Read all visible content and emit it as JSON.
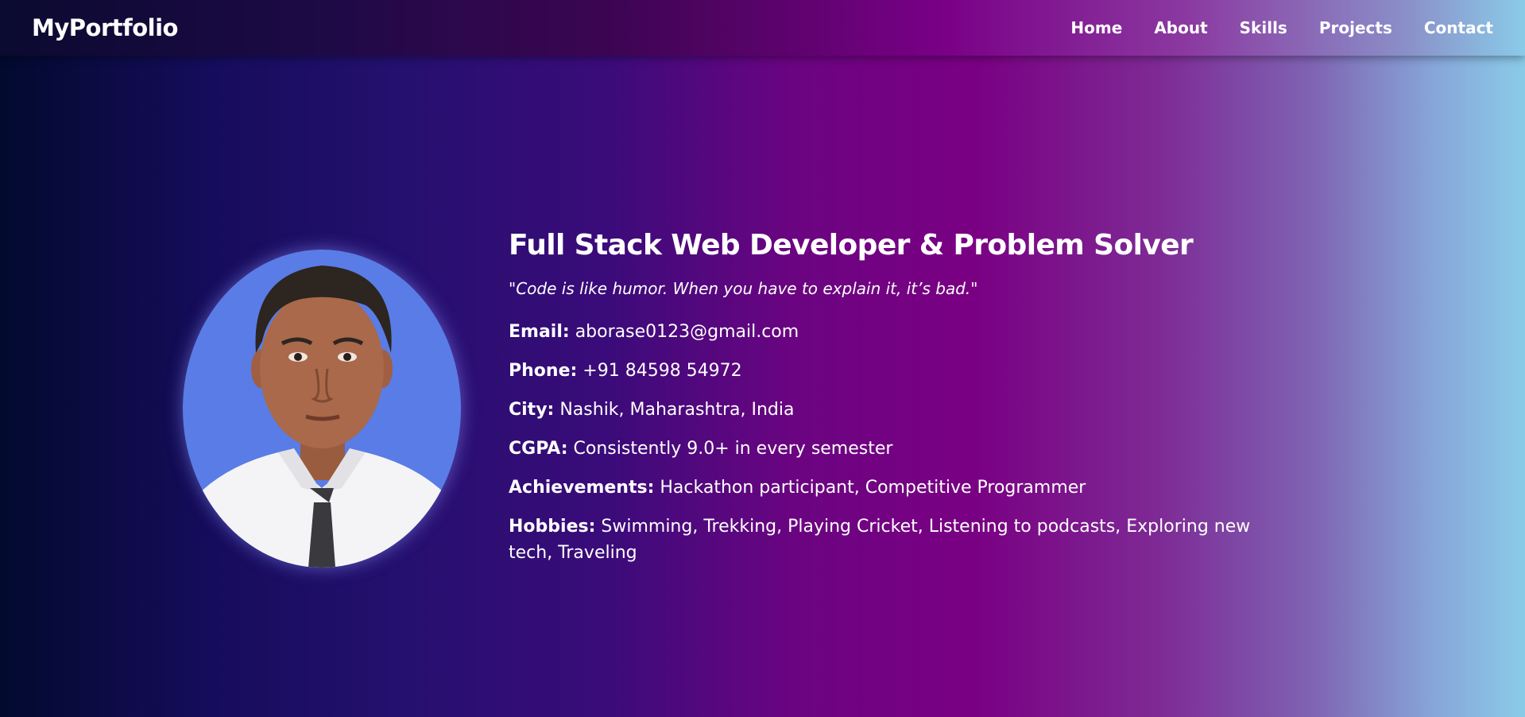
{
  "nav": {
    "logo": "MyPortfolio",
    "links": [
      {
        "label": "Home"
      },
      {
        "label": "About"
      },
      {
        "label": "Skills"
      },
      {
        "label": "Projects"
      },
      {
        "label": "Contact"
      }
    ]
  },
  "profile": {
    "photo_icon": "profile-photo",
    "headline": "Full Stack Web Developer & Problem Solver",
    "quote": "\"Code is like humor. When you have to explain it, it’s bad.\"",
    "details": [
      {
        "key": "Email:",
        "value": "aborase0123@gmail.com"
      },
      {
        "key": "Phone:",
        "value": "+91 84598 54972"
      },
      {
        "key": "City:",
        "value": "Nashik, Maharashtra, India"
      },
      {
        "key": "CGPA:",
        "value": "Consistently 9.0+ in every semester"
      },
      {
        "key": "Achievements:",
        "value": "Hackathon participant, Competitive Programmer"
      },
      {
        "key": "Hobbies:",
        "value": "Swimming, Trekking, Playing Cricket, Listening to podcasts, Exploring new tech, Traveling"
      }
    ]
  },
  "colors": {
    "photo_background": "#5a7ce6",
    "shirt": "#f4f4f6",
    "tie": "#3a3a3e",
    "skin": "#a9694a",
    "hair": "#2c2520"
  }
}
